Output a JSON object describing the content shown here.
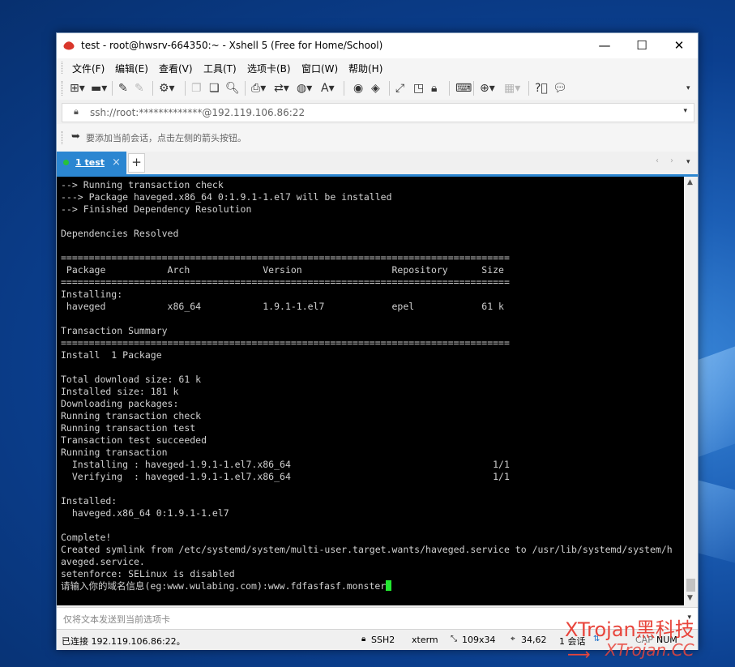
{
  "window": {
    "title": "test - root@hwsrv-664350:~ - Xshell 5 (Free for Home/School)",
    "minimize": "—",
    "maximize": "☐",
    "close": "✕"
  },
  "menu": [
    "文件(F)",
    "编辑(E)",
    "查看(V)",
    "工具(T)",
    "选项卡(B)",
    "窗口(W)",
    "帮助(H)"
  ],
  "toolbar_icons": [
    "new-session-icon",
    "open-folder-icon",
    "reconnect-icon",
    "disconnect-icon",
    "properties-icon",
    "copy-icon",
    "paste-icon",
    "find-icon",
    "print-icon",
    "transfer-icon",
    "globe-icon",
    "font-icon",
    "xftp-icon",
    "xmanager-icon",
    "fullscreen-icon",
    "transparent-icon",
    "lock-icon",
    "keyboard-icon",
    "add-icon",
    "layout-icon",
    "help-icon",
    "chat-icon"
  ],
  "address": {
    "text": "ssh://root:*************@192.119.106.86:22"
  },
  "info": {
    "text": "要添加当前会话，点击左侧的箭头按钮。"
  },
  "tabs": [
    {
      "label": "1 test",
      "close": "×"
    }
  ],
  "tab_add": "+",
  "terminal": {
    "lines": [
      "--> Running transaction check",
      "---> Package haveged.x86_64 0:1.9.1-1.el7 will be installed",
      "--> Finished Dependency Resolution",
      "",
      "Dependencies Resolved",
      "",
      "================================================================================",
      " Package           Arch             Version                Repository      Size",
      "================================================================================",
      "Installing:",
      " haveged           x86_64           1.9.1-1.el7            epel            61 k",
      "",
      "Transaction Summary",
      "================================================================================",
      "Install  1 Package",
      "",
      "Total download size: 61 k",
      "Installed size: 181 k",
      "Downloading packages:",
      "Running transaction check",
      "Running transaction test",
      "Transaction test succeeded",
      "Running transaction",
      "  Installing : haveged-1.9.1-1.el7.x86_64                                    1/1",
      "  Verifying  : haveged-1.9.1-1.el7.x86_64                                    1/1",
      "",
      "Installed:",
      "  haveged.x86_64 0:1.9.1-1.el7",
      "",
      "Complete!",
      "Created symlink from /etc/systemd/system/multi-user.target.wants/haveged.service to /usr/lib/systemd/system/h",
      "aveged.service.",
      "setenforce: SELinux is disabled"
    ],
    "prompt": "请输入你的域名信息(eg:www.wulabing.com):www.fdfasfasf.monster"
  },
  "input_bar": {
    "placeholder": "仅将文本发送到当前选项卡"
  },
  "status": {
    "connection": "已连接 192.119.106.86:22。",
    "protocol": "SSH2",
    "terminal_type": "xterm",
    "size": "109x34",
    "cursor_pos": "34,62",
    "sessions": "1 会话",
    "caps": "CAP",
    "num": "NUM"
  },
  "watermark": {
    "line1": "XTrojan黑科技",
    "line2": "XTrojan.CC"
  },
  "colors": {
    "accent": "#2b86d1",
    "cursor": "#22e830",
    "watermark": "#e8453c"
  }
}
